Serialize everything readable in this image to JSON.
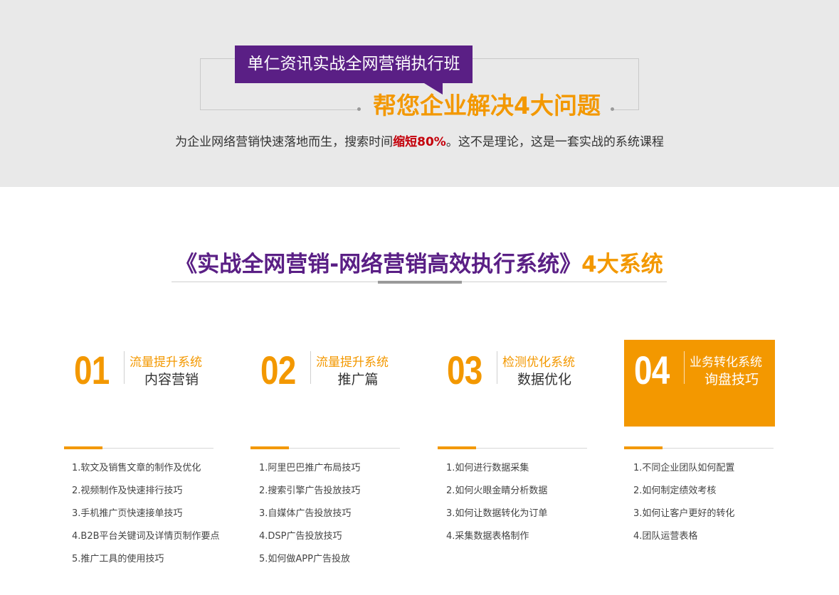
{
  "banner": {
    "badge": "单仁资讯实战全网营销执行班",
    "headline": "帮您企业解决4大问题",
    "sub_before": "为企业网络营销快速落地而生，搜索时间",
    "sub_highlight": "缩短80%",
    "sub_after": "。这不是理论，这是一套实战的系统课程"
  },
  "section": {
    "title_main": "《实战全网营销-网络营销高效执行系统》",
    "title_accent": "4大系统"
  },
  "systems": [
    {
      "num": "01",
      "category": "流量提升系统",
      "name": "内容营销",
      "items": [
        "1.软文及销售文章的制作及优化",
        "2.视频制作及快速排行技巧",
        "3.手机推广页快速接单技巧",
        "4.B2B平台关键词及详情页制作要点",
        "5.推广工具的使用技巧"
      ]
    },
    {
      "num": "02",
      "category": "流量提升系统",
      "name": "推广篇",
      "items": [
        "1.阿里巴巴推广布局技巧",
        "2.搜索引擎广告投放技巧",
        "3.自媒体广告投放技巧",
        "4.DSP广告投放技巧",
        "5.如何做APP广告投放"
      ]
    },
    {
      "num": "03",
      "category": "检测优化系统",
      "name": "数据优化",
      "items": [
        "1.如何进行数据采集",
        "2.如何火眼金睛分析数据",
        "3.如何让数据转化为订单",
        "4.采集数据表格制作"
      ]
    },
    {
      "num": "04",
      "category": "业务转化系统",
      "name": "询盘技巧",
      "items": [
        "1.不同企业团队如何配置",
        "2.如何制定绩效考核",
        "3.如何让客户更好的转化",
        "4.团队运营表格"
      ]
    }
  ],
  "colors": {
    "purple": "#5a1f85",
    "orange": "#f39800",
    "red": "#c4000b"
  }
}
